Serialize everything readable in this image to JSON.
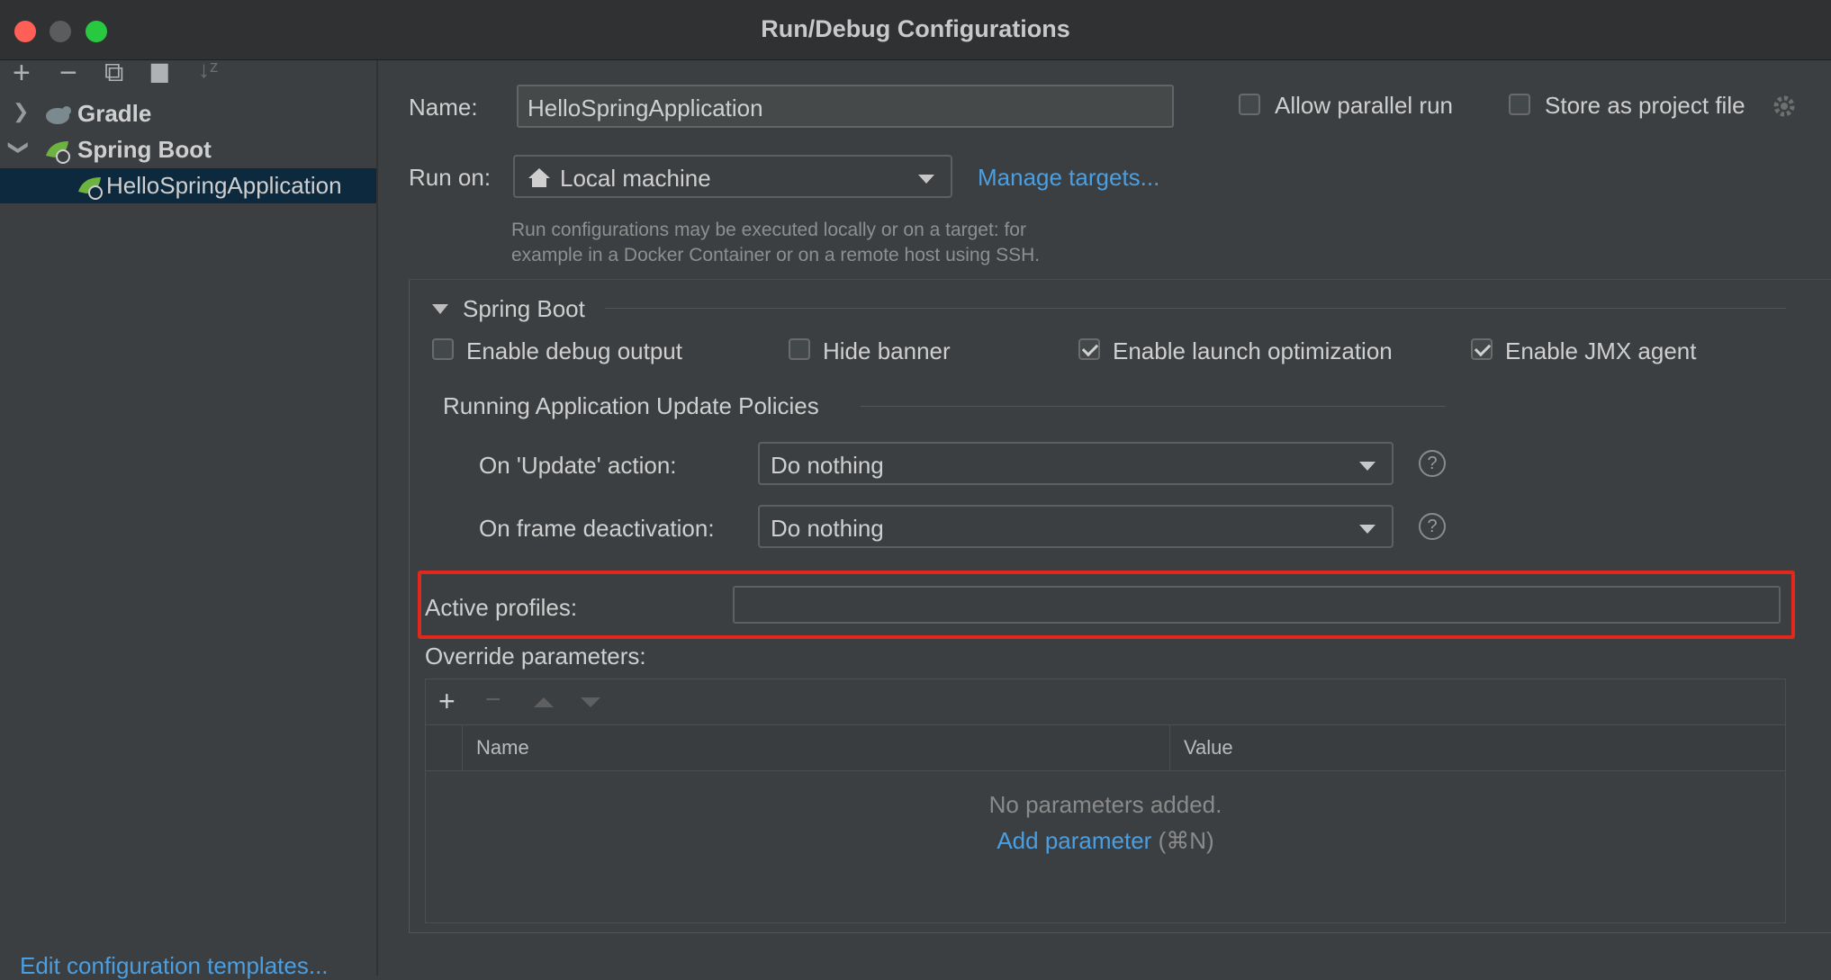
{
  "window": {
    "title": "Run/Debug Configurations"
  },
  "toolbar": {
    "add": "+",
    "remove": "−",
    "copy": "⧉",
    "folder": "▆",
    "sort": "↓ᶻ"
  },
  "tree": {
    "gradle": "Gradle",
    "spring_boot": "Spring Boot",
    "app": "HelloSpringApplication"
  },
  "edit_templates": "Edit configuration templates...",
  "form": {
    "name_label": "Name:",
    "name_value": "HelloSpringApplication",
    "allow_parallel": "Allow parallel run",
    "store_project": "Store as project file",
    "run_on_label": "Run on:",
    "run_on_value": "Local machine",
    "manage_targets": "Manage targets...",
    "hint_line1": "Run configurations may be executed locally or on a target: for",
    "hint_line2": "example in a Docker Container or on a remote host using SSH."
  },
  "spring": {
    "section_title": "Spring Boot",
    "debug_output": "Enable debug output",
    "hide_banner": "Hide banner",
    "launch_opt": "Enable launch optimization",
    "jmx": "Enable JMX agent",
    "checks": {
      "debug_output": false,
      "hide_banner": false,
      "launch_opt": true,
      "jmx": true
    },
    "policies_title": "Running Application Update Policies",
    "update_label": "On 'Update' action:",
    "update_value": "Do nothing",
    "frame_label": "On frame deactivation:",
    "frame_value": "Do nothing",
    "help": "?",
    "active_profiles_label": "Active profiles:",
    "active_profiles_value": "",
    "override_label": "Override parameters:",
    "table_add": "+",
    "table_remove": "−",
    "col_name": "Name",
    "col_value": "Value",
    "empty_text": "No parameters added.",
    "add_param": "Add parameter",
    "add_param_shortcut": "(⌘N)"
  },
  "colors": {
    "highlight": "#e0291c",
    "link": "#4a9fe3",
    "selection": "#0d293e"
  }
}
